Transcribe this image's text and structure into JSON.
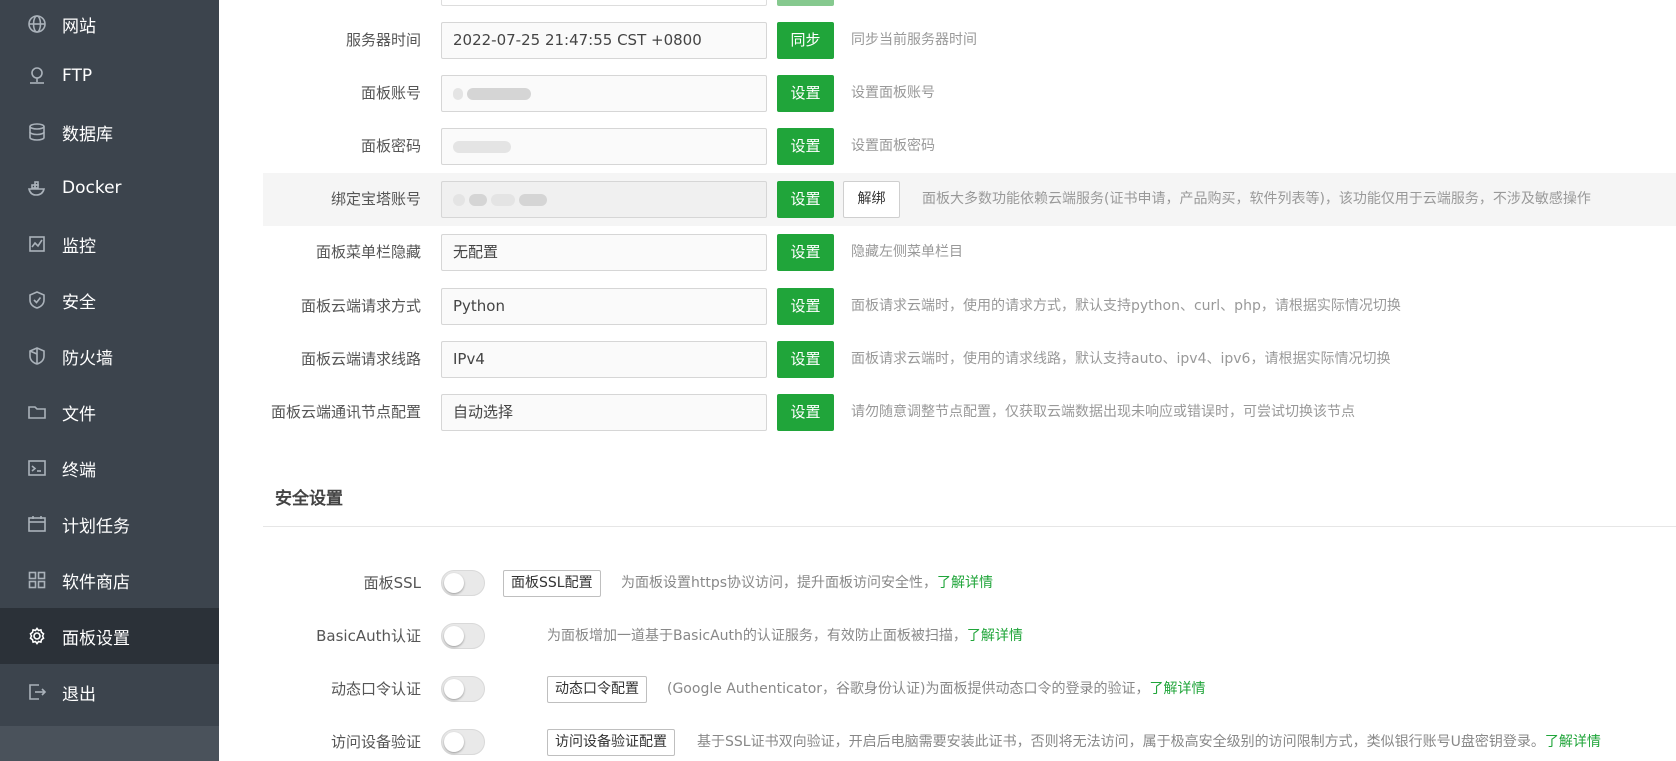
{
  "sidebar": {
    "items": [
      {
        "label": "网站",
        "icon": "globe-icon"
      },
      {
        "label": "FTP",
        "icon": "ftp-icon"
      },
      {
        "label": "数据库",
        "icon": "database-icon"
      },
      {
        "label": "Docker",
        "icon": "docker-icon"
      },
      {
        "label": "监控",
        "icon": "monitor-icon"
      },
      {
        "label": "安全",
        "icon": "shield-check-icon"
      },
      {
        "label": "防火墙",
        "icon": "firewall-icon"
      },
      {
        "label": "文件",
        "icon": "folder-icon"
      },
      {
        "label": "终端",
        "icon": "terminal-icon"
      },
      {
        "label": "计划任务",
        "icon": "calendar-icon"
      },
      {
        "label": "软件商店",
        "icon": "apps-grid-icon"
      },
      {
        "label": "面板设置",
        "icon": "gear-icon",
        "active": true
      },
      {
        "label": "退出",
        "icon": "logout-icon"
      }
    ]
  },
  "settings": {
    "server_time": {
      "label": "服务器时间",
      "value": "2022-07-25 21:47:55 CST +0800",
      "button": "同步",
      "desc": "同步当前服务器时间"
    },
    "panel_account": {
      "label": "面板账号",
      "button": "设置",
      "desc": "设置面板账号"
    },
    "panel_password": {
      "label": "面板密码",
      "button": "设置",
      "desc": "设置面板密码"
    },
    "bt_account": {
      "label": "绑定宝塔账号",
      "button": "设置",
      "button2": "解绑",
      "desc": "面板大多数功能依赖云端服务(证书申请，产品购买，软件列表等)，该功能仅用于云端服务，不涉及敏感操作"
    },
    "menu_hide": {
      "label": "面板菜单栏隐藏",
      "value": "无配置",
      "button": "设置",
      "desc": "隐藏左侧菜单栏目"
    },
    "request_method": {
      "label": "面板云端请求方式",
      "value": "Python",
      "button": "设置",
      "desc": "面板请求云端时，使用的请求方式，默认支持python、curl、php，请根据实际情况切换"
    },
    "request_line": {
      "label": "面板云端请求线路",
      "value": "IPv4",
      "button": "设置",
      "desc": "面板请求云端时，使用的请求线路，默认支持auto、ipv4、ipv6，请根据实际情况切换"
    },
    "node_config": {
      "label": "面板云端通讯节点配置",
      "value": "自动选择",
      "button": "设置",
      "desc": "请勿随意调整节点配置，仅获取云端数据出现未响应或错误时，可尝试切换该节点"
    }
  },
  "security": {
    "title": "安全设置",
    "ssl": {
      "label": "面板SSL",
      "button": "面板SSL配置",
      "desc": "为面板设置https协议访问，提升面板访问安全性，",
      "link": "了解详情",
      "enabled": false
    },
    "basic_auth": {
      "label": "BasicAuth认证",
      "desc": "为面板增加一道基于BasicAuth的认证服务，有效防止面板被扫描，",
      "link": "了解详情",
      "enabled": false
    },
    "totp": {
      "label": "动态口令认证",
      "button": "动态口令配置",
      "desc": "(Google Authenticator，谷歌身份认证)为面板提供动态口令的登录的验证，",
      "link": "了解详情",
      "enabled": false
    },
    "device": {
      "label": "访问设备验证",
      "button": "访问设备验证配置",
      "desc": "基于SSL证书双向验证，开启后电脑需要安装此证书，否则将无法访问，属于极高安全级别的访问限制方式，类似银行账号U盘密钥登录。",
      "link": "了解详情",
      "enabled": false
    }
  },
  "colors": {
    "sidebar_bg": "#3c444d",
    "accent": "#20a53a"
  }
}
